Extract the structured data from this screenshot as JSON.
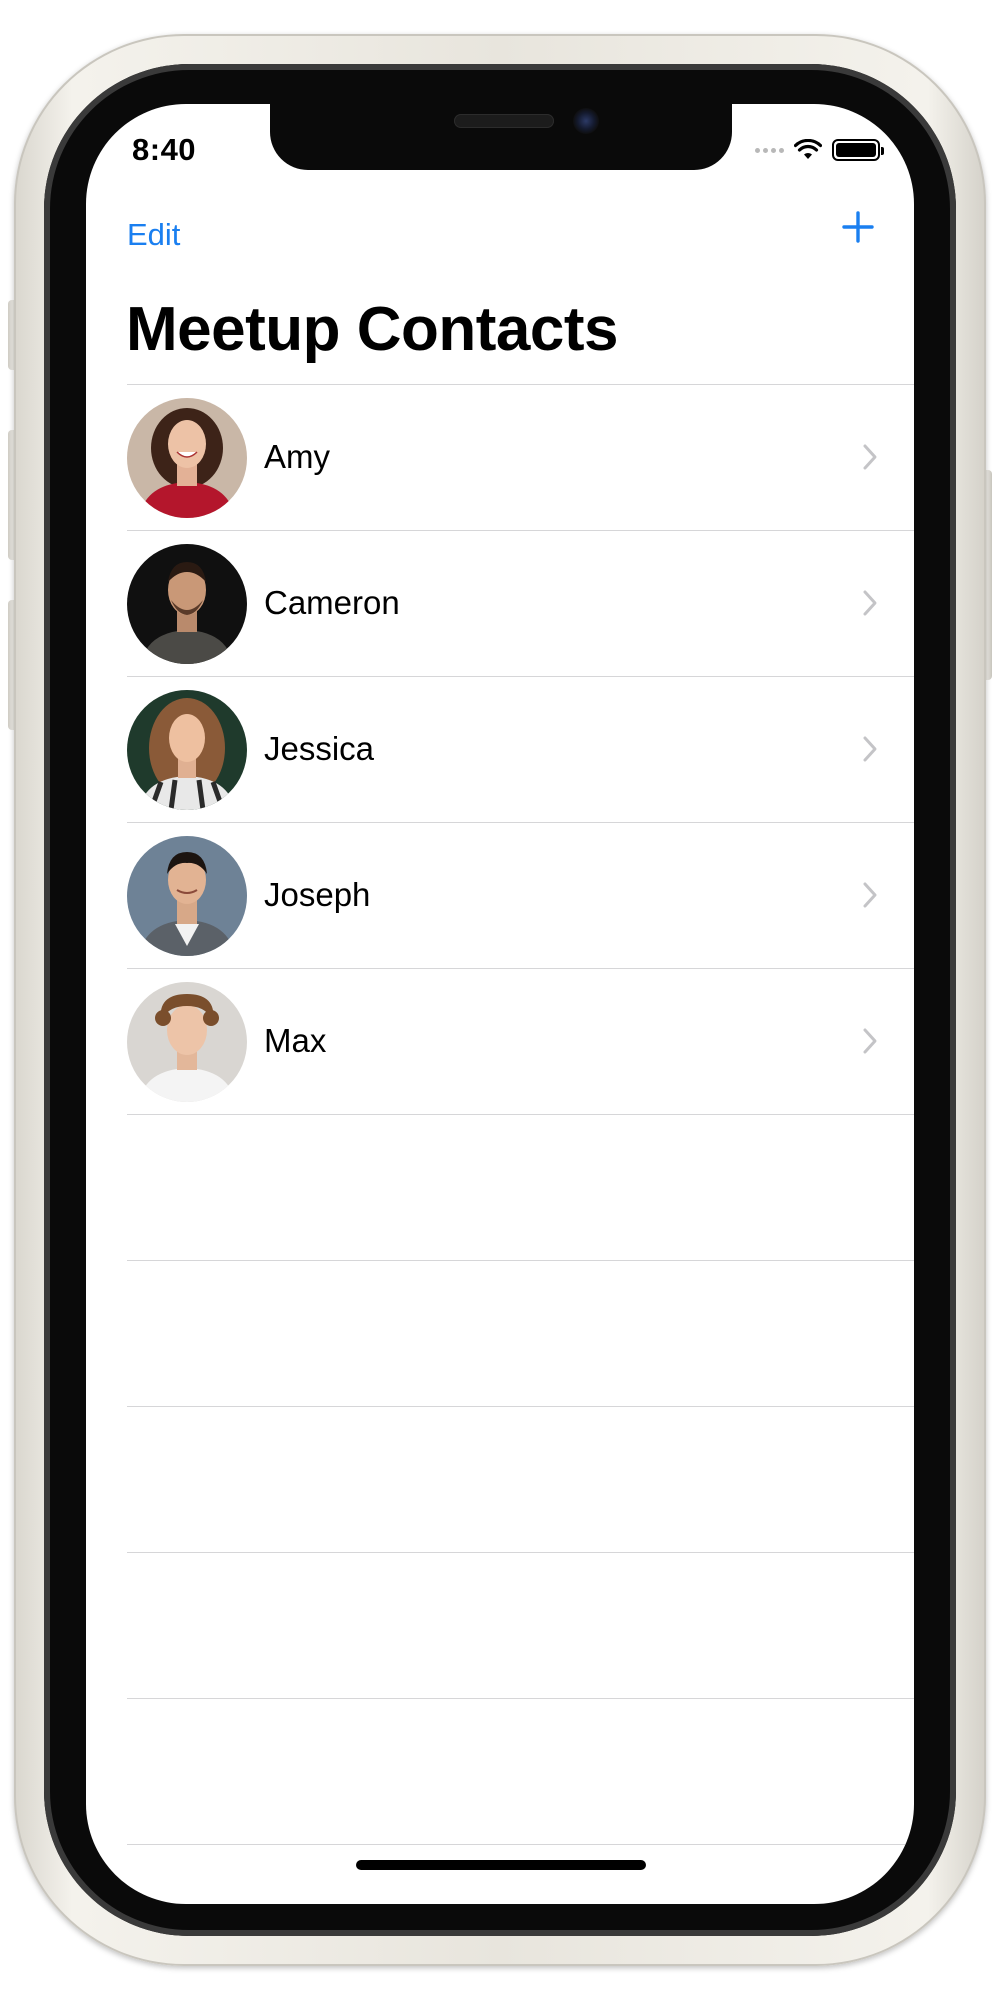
{
  "status_bar": {
    "time": "8:40",
    "icons": [
      "cellular-signal-icon",
      "wifi-icon",
      "battery-icon"
    ]
  },
  "nav": {
    "edit_label": "Edit",
    "add_icon": "plus-icon",
    "title": "Meetup Contacts"
  },
  "contacts": [
    {
      "name": "Amy"
    },
    {
      "name": "Cameron"
    },
    {
      "name": "Jessica"
    },
    {
      "name": "Joseph"
    },
    {
      "name": "Max"
    }
  ],
  "colors": {
    "accent": "#1a7ff0",
    "separator": "#d6d6d8",
    "chevron": "#c4c4c7"
  }
}
